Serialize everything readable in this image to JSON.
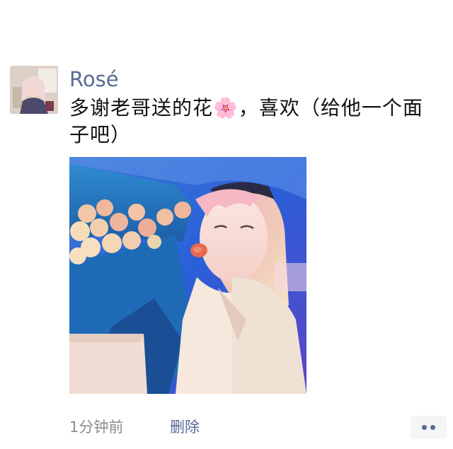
{
  "post": {
    "username": "Rosé",
    "caption": "多谢老哥送的花🌸，喜欢（给他一个面子吧）",
    "time": "1分钟前",
    "delete_label": "删除",
    "more_icon": "ellipsis-icon"
  },
  "colors": {
    "link": "#576b95",
    "text": "#111111",
    "meta": "#8c8c8c",
    "more_bg": "#f4f5f7"
  }
}
